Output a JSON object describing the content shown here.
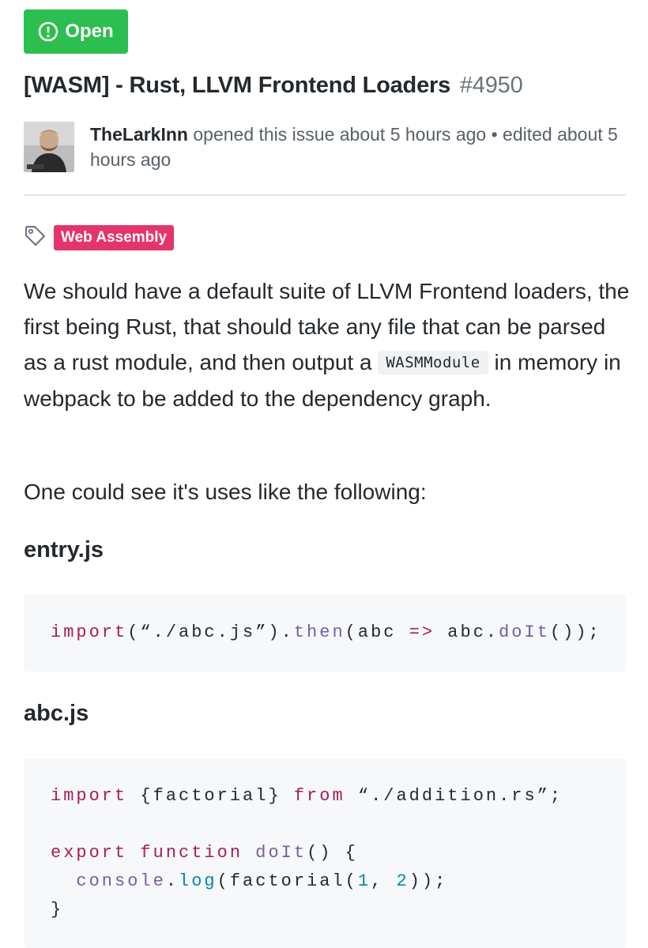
{
  "status": {
    "label": "Open",
    "icon": "issue-opened-icon",
    "color": "#2cbe4e"
  },
  "issue": {
    "title": "[WASM] - Rust, LLVM Frontend Loaders",
    "number": "#4950"
  },
  "meta": {
    "author": "TheLarkInn",
    "opened_text": "opened this issue about 5 hours ago",
    "separator": "•",
    "edited_text": "edited about 5 hours ago"
  },
  "labels": [
    {
      "name": "Web Assembly",
      "color": "#e4346b"
    }
  ],
  "body": {
    "paragraph1_before": "We should have a default suite of LLVM Frontend loaders, the first being Rust, that should take any file that can be parsed as a rust module, and then output a ",
    "inline_code": "WASMModule",
    "paragraph1_after": " in memory in webpack to be added to the dependency graph.",
    "paragraph2": "One could see it's uses like the following:",
    "file1_heading": "entry.js",
    "file2_heading": "abc.js"
  },
  "code": {
    "entry": {
      "import": "import",
      "open": "(",
      "path": "“./abc.js”",
      "close_dot": ").",
      "then": "then",
      "args": "(abc ",
      "arrow": "=>",
      "call": " abc.",
      "doit": "doIt",
      "end": "());"
    },
    "abc": {
      "line1_import": "import",
      "line1_names": " {factorial} ",
      "line1_from": "from",
      "line1_path": " “./addition.rs”;",
      "line2_export": "export",
      "line2_function": "function",
      "line2_name": "doIt",
      "line2_rest": "() {",
      "line3_obj": "console",
      "line3_dot": ".",
      "line3_log": "log",
      "line3_open": "(factorial(",
      "line3_n1": "1",
      "line3_comma": ", ",
      "line3_n2": "2",
      "line3_close": "));",
      "line4": "}"
    }
  }
}
